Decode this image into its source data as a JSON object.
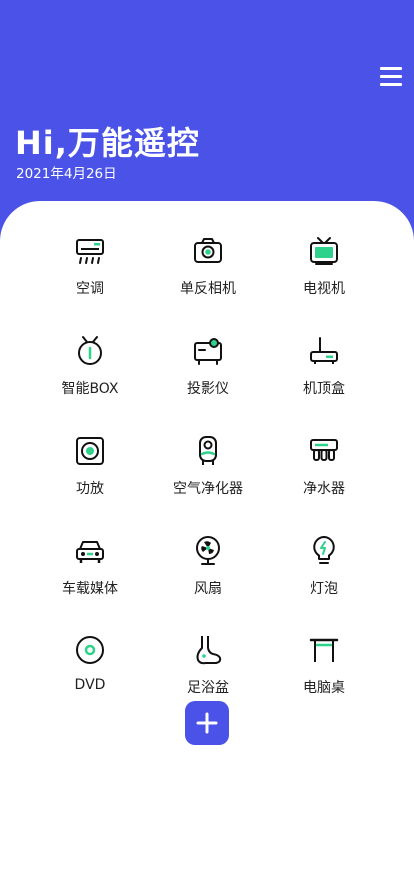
{
  "theme": {
    "primary": "#4a52e8",
    "accent": "#2fd28a",
    "icon_stroke": "#111111"
  },
  "header": {
    "title": "Hi,万能遥控",
    "date": "2021年4月26日",
    "menu_icon": "hamburger-menu-icon"
  },
  "devices": [
    {
      "label": "空调",
      "icon": "air-conditioner-icon"
    },
    {
      "label": "单反相机",
      "icon": "camera-icon"
    },
    {
      "label": "电视机",
      "icon": "tv-icon"
    },
    {
      "label": "智能BOX",
      "icon": "smart-box-icon"
    },
    {
      "label": "投影仪",
      "icon": "projector-icon"
    },
    {
      "label": "机顶盒",
      "icon": "set-top-box-icon"
    },
    {
      "label": "功放",
      "icon": "amplifier-icon"
    },
    {
      "label": "空气净化器",
      "icon": "air-purifier-icon"
    },
    {
      "label": "净水器",
      "icon": "water-purifier-icon"
    },
    {
      "label": "车载媒体",
      "icon": "car-media-icon"
    },
    {
      "label": "风扇",
      "icon": "fan-icon"
    },
    {
      "label": "灯泡",
      "icon": "light-bulb-icon"
    },
    {
      "label": "DVD",
      "icon": "dvd-icon"
    },
    {
      "label": "足浴盆",
      "icon": "foot-bath-icon"
    },
    {
      "label": "电脑桌",
      "icon": "computer-desk-icon"
    }
  ],
  "add_button": {
    "icon": "plus-icon"
  }
}
